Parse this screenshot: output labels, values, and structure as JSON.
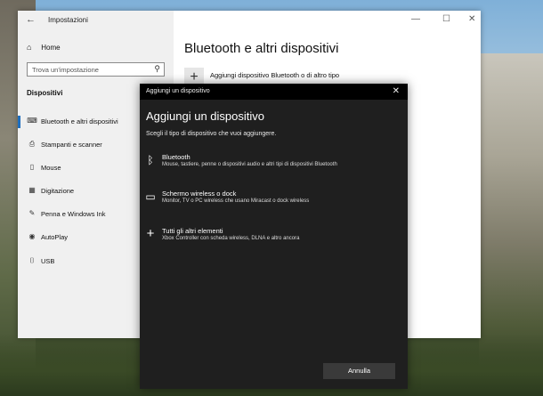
{
  "settings": {
    "title": "Impostazioni",
    "home_label": "Home",
    "search_placeholder": "Trova un'impostazione",
    "section_label": "Dispositivi",
    "nav_items": [
      {
        "label": "Bluetooth e altri dispositivi",
        "icon": "bluetooth-devices-icon",
        "active": true
      },
      {
        "label": "Stampanti e scanner",
        "icon": "printer-icon",
        "active": false
      },
      {
        "label": "Mouse",
        "icon": "mouse-icon",
        "active": false
      },
      {
        "label": "Digitazione",
        "icon": "keyboard-icon",
        "active": false
      },
      {
        "label": "Penna e Windows Ink",
        "icon": "pen-icon",
        "active": false
      },
      {
        "label": "AutoPlay",
        "icon": "autoplay-icon",
        "active": false
      },
      {
        "label": "USB",
        "icon": "usb-icon",
        "active": false
      }
    ],
    "page_title": "Bluetooth e altri dispositivi",
    "add_device_label": "Aggiungi dispositivo Bluetooth o di altro tipo"
  },
  "dialog": {
    "window_title": "Aggiungi un dispositivo",
    "heading": "Aggiungi un dispositivo",
    "subtitle": "Scegli il tipo di dispositivo che vuoi aggiungere.",
    "options": [
      {
        "name": "Bluetooth",
        "desc": "Mouse, tastiere, penne o dispositivi audio e altri tipi di dispositivi Bluetooth",
        "icon": "bluetooth-icon"
      },
      {
        "name": "Schermo wireless o dock",
        "desc": "Monitor, TV o PC wireless che usano Miracast o dock wireless",
        "icon": "monitor-icon"
      },
      {
        "name": "Tutti gli altri elementi",
        "desc": "Xbox Controller con scheda wireless, DLNA e altro ancora",
        "icon": "plus-icon"
      }
    ],
    "cancel_label": "Annulla"
  }
}
